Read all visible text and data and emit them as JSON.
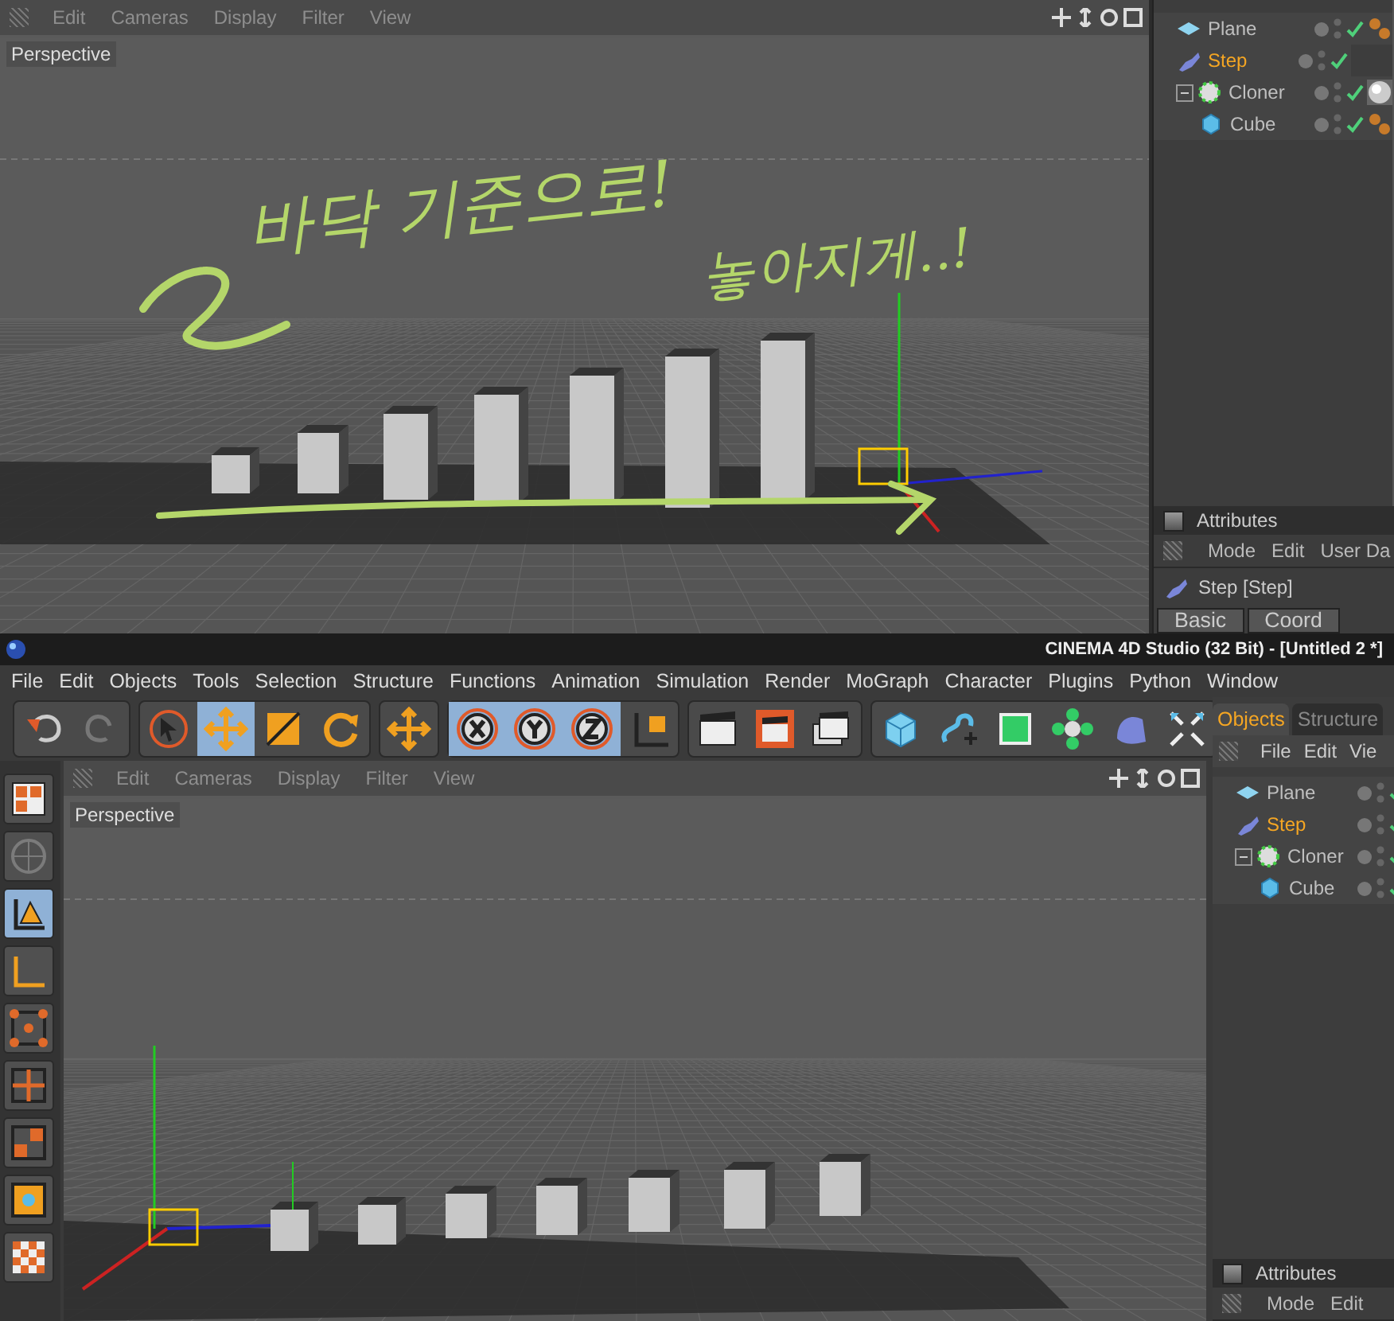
{
  "top_window": {
    "viewport": {
      "menu": [
        "Edit",
        "Cameras",
        "Display",
        "Filter",
        "View"
      ],
      "label": "Perspective"
    },
    "annotation": {
      "lines": [
        "바닥 기준으로!",
        "놓아지게..!"
      ]
    },
    "objects": [
      {
        "name": "Plane",
        "kind": "plane",
        "selected": false,
        "tag": {
          "kind": "phong"
        }
      },
      {
        "name": "Step",
        "kind": "effector",
        "selected": true
      },
      {
        "name": "Cloner",
        "kind": "cloner",
        "selected": false,
        "expanded": true,
        "tag": {
          "kind": "material"
        },
        "children": [
          {
            "name": "Cube",
            "kind": "cube",
            "selected": false,
            "tag": {
              "kind": "phong"
            }
          }
        ]
      }
    ],
    "attributes": {
      "title": "Attributes",
      "menu": [
        "Mode",
        "Edit",
        "User Da"
      ],
      "object": "Step [Step]",
      "tabs": [
        "Basic",
        "Coord"
      ]
    }
  },
  "main_window": {
    "title": "CINEMA 4D Studio (32 Bit) - [Untitled 2 *]",
    "menu": [
      "File",
      "Edit",
      "Objects",
      "Tools",
      "Selection",
      "Structure",
      "Functions",
      "Animation",
      "Simulation",
      "Render",
      "MoGraph",
      "Character",
      "Plugins",
      "Python",
      "Window"
    ],
    "toolbar": [
      [
        {
          "kind": "undo",
          "selected": false,
          "disabled": false
        },
        {
          "kind": "redo",
          "selected": false,
          "disabled": true
        }
      ],
      [
        {
          "kind": "select",
          "selected": false,
          "disabled": false
        },
        {
          "kind": "move",
          "selected": true,
          "disabled": false
        },
        {
          "kind": "scale",
          "selected": false,
          "disabled": false
        },
        {
          "kind": "rotate",
          "selected": false,
          "disabled": false
        }
      ],
      [
        {
          "kind": "move",
          "selected": false,
          "disabled": false
        }
      ],
      [
        {
          "kind": "x",
          "selected": true,
          "disabled": false
        },
        {
          "kind": "y",
          "selected": true,
          "disabled": false
        },
        {
          "kind": "z",
          "selected": true,
          "disabled": false
        },
        {
          "kind": "coords",
          "selected": false,
          "disabled": false
        }
      ],
      [
        {
          "kind": "render-view",
          "selected": false,
          "disabled": false
        },
        {
          "kind": "render",
          "selected": false,
          "disabled": false
        },
        {
          "kind": "render-settings",
          "selected": false,
          "disabled": false
        }
      ],
      [
        {
          "kind": "cube",
          "selected": false,
          "disabled": false
        },
        {
          "kind": "spline",
          "selected": false,
          "disabled": false
        },
        {
          "kind": "subdivide",
          "selected": false,
          "disabled": false
        },
        {
          "kind": "cloner",
          "selected": false,
          "disabled": false
        },
        {
          "kind": "deformer",
          "selected": false,
          "disabled": false
        },
        {
          "kind": "scene",
          "selected": false,
          "disabled": false
        }
      ]
    ],
    "modes": [
      {
        "kind": "layout",
        "selected": false,
        "disabled": false
      },
      {
        "kind": "model",
        "selected": false,
        "disabled": true
      },
      {
        "kind": "object",
        "selected": true,
        "disabled": false
      },
      {
        "kind": "axis",
        "selected": false,
        "disabled": false
      },
      {
        "kind": "points",
        "selected": false,
        "disabled": false
      },
      {
        "kind": "edges",
        "selected": false,
        "disabled": false
      },
      {
        "kind": "polygons",
        "selected": false,
        "disabled": false
      },
      {
        "kind": "uv",
        "selected": false,
        "disabled": false
      },
      {
        "kind": "texture",
        "selected": false,
        "disabled": false
      }
    ],
    "viewport": {
      "menu": [
        "Edit",
        "Cameras",
        "Display",
        "Filter",
        "View"
      ],
      "label": "Perspective"
    },
    "panel_tabs": [
      {
        "label": "Objects",
        "selected": true
      },
      {
        "label": "Structure",
        "selected": false
      }
    ],
    "panel_menu": [
      "File",
      "Edit",
      "Vie"
    ],
    "objects": [
      {
        "name": "Plane",
        "kind": "plane",
        "selected": false
      },
      {
        "name": "Step",
        "kind": "effector",
        "selected": true
      },
      {
        "name": "Cloner",
        "kind": "cloner",
        "selected": false,
        "expanded": true,
        "children": [
          {
            "name": "Cube",
            "kind": "cube",
            "selected": false
          }
        ]
      }
    ],
    "attributes": {
      "title": "Attributes",
      "menu": [
        "Mode",
        "Edit"
      ]
    }
  }
}
